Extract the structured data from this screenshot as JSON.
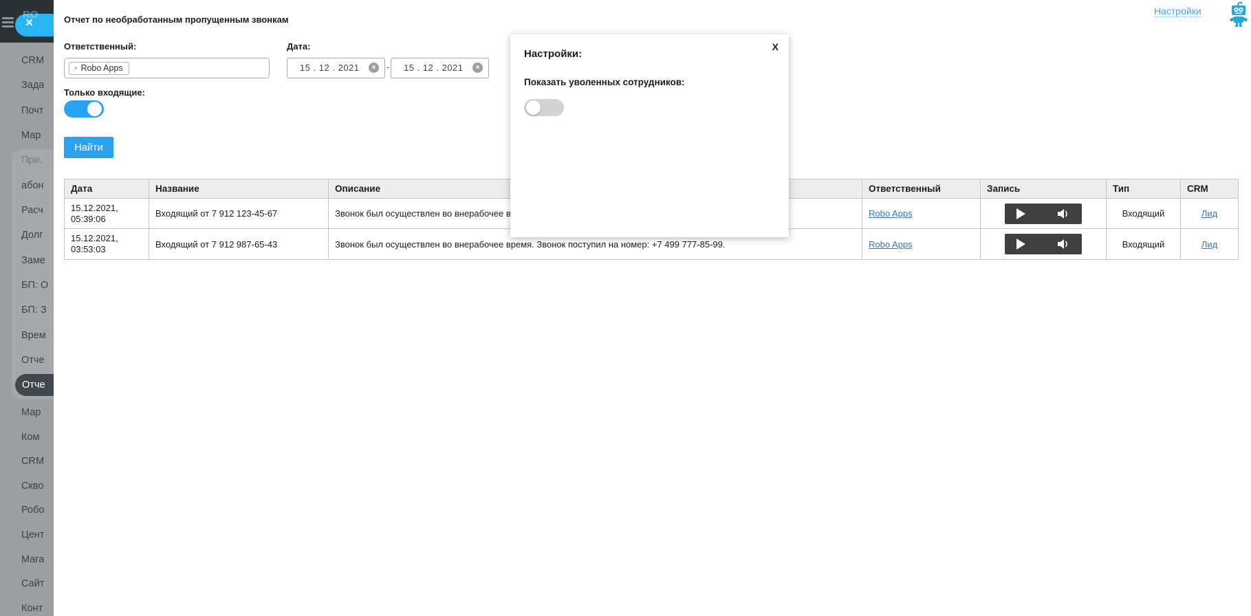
{
  "header": {
    "settings_link": "Настройки"
  },
  "sidebar": {
    "logo_fragment": "RO",
    "close_label": "×",
    "items": [
      {
        "label": "CRM"
      },
      {
        "label": "Зада"
      },
      {
        "label": "Почт"
      },
      {
        "label": "Мар"
      },
      {
        "label": "При.",
        "muted": true
      },
      {
        "label": "абон"
      },
      {
        "label": "Расч"
      },
      {
        "label": "Долг"
      },
      {
        "label": "Заме"
      },
      {
        "label": "БП: О"
      },
      {
        "label": "БП: З"
      },
      {
        "label": "Врем"
      },
      {
        "label": "Отче"
      },
      {
        "label": "Отче",
        "selected": true
      },
      {
        "label": "Мар"
      },
      {
        "label": "Ком"
      },
      {
        "label": "CRM"
      },
      {
        "label": "Скво"
      },
      {
        "label": "Робо"
      },
      {
        "label": "Цент"
      },
      {
        "label": "Мага"
      },
      {
        "label": "Сайт"
      },
      {
        "label": "Конт"
      }
    ]
  },
  "report": {
    "title": "Отчет по необработанным пропущенным звонкам",
    "filters": {
      "responsible_label": "Ответственный:",
      "responsible_tag": "Robo Apps",
      "tag_remove": "×",
      "date_label": "Дата:",
      "date_from": "15 . 12 . 2021",
      "date_to": "15 . 12 . 2021",
      "date_separator": "-",
      "clear_icon": "×",
      "incoming_only_label": "Только входящие:",
      "incoming_only_on": true,
      "search_button": "Найти"
    },
    "table": {
      "headers": [
        "Дата",
        "Название",
        "Описание",
        "Ответственный",
        "Запись",
        "Тип",
        "CRM"
      ],
      "rows": [
        {
          "date": "15.12.2021,",
          "time": "05:39:06",
          "name": "Входящий от 7 912 123-45-67",
          "description": "Звонок был осуществлен во внерабочее врем",
          "responsible": "Robo Apps",
          "type": "Входящий",
          "crm": "Лид"
        },
        {
          "date": "15.12.2021,",
          "time": "03:53:03",
          "name": "Входящий от 7 912 987-65-43",
          "description": "Звонок был осуществлен во внерабочее время. Звонок поступил на номер: +7 499 777-85-99.",
          "responsible": "Robo Apps",
          "type": "Входящий",
          "crm": "Лид"
        }
      ]
    }
  },
  "modal": {
    "title": "Настройки:",
    "close_label": "X",
    "show_fired_label": "Показать уволенных сотрудников:",
    "show_fired_on": false
  },
  "colors": {
    "accent_blue": "#2aa2f0",
    "close_blue": "#29b5f4",
    "link_blue": "#3575c0",
    "settings_link_blue": "#4ba7e0",
    "player_dark": "#404040",
    "sidebar_gray": "#9b9fa2",
    "selected_pill": "#41484d"
  }
}
